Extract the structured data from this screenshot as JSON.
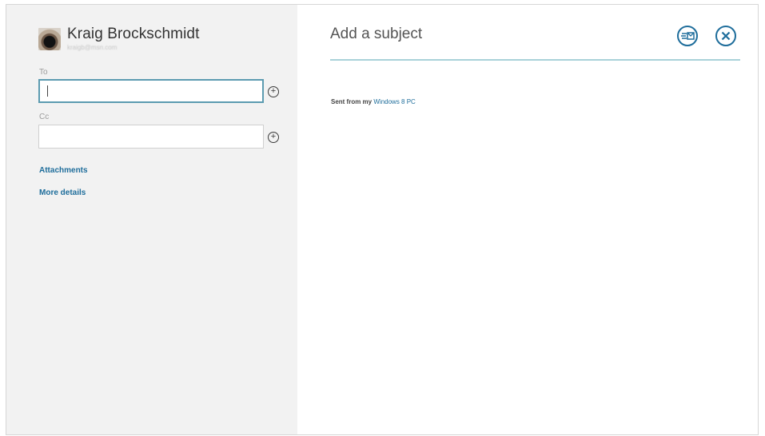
{
  "account": {
    "name": "Kraig Brockschmidt",
    "email": "kraigb@msn.com"
  },
  "to_field": {
    "label": "To",
    "value": ""
  },
  "cc_field": {
    "label": "Cc",
    "value": ""
  },
  "links": {
    "attachments": "Attachments",
    "more_details": "More details"
  },
  "subject": {
    "placeholder": "Add a subject"
  },
  "body": {
    "signature_prefix": "Sent from my",
    "signature_link": "Windows 8 PC"
  },
  "icons": {
    "send": "send-icon",
    "close": "close-icon",
    "add": "plus-circle-icon"
  },
  "colors": {
    "accent": "#1e6d9b",
    "focus_border": "#5c9bb0",
    "subject_underline": "#a9d2d9",
    "left_pane_bg": "#f2f2f2"
  }
}
